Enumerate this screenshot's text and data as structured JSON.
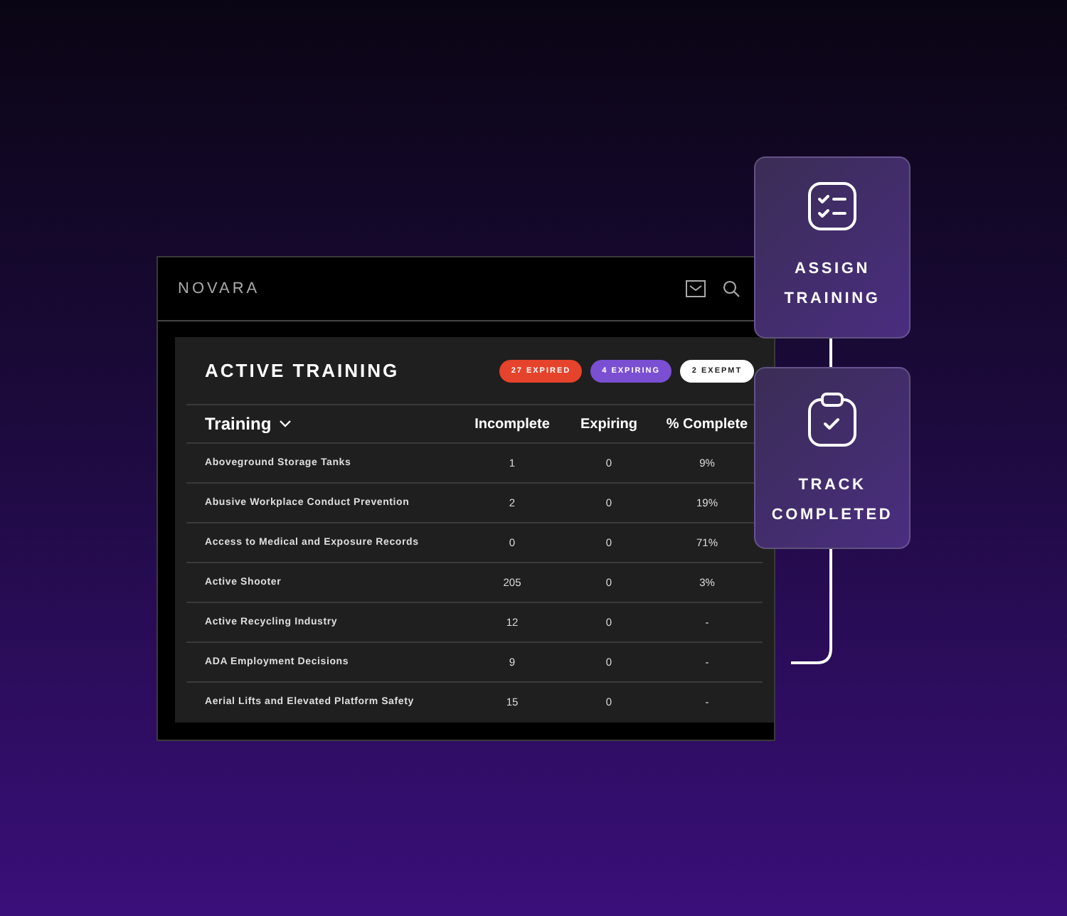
{
  "app": {
    "logo": "NOVARA"
  },
  "panel": {
    "title": "ACTIVE TRAINING",
    "badges": [
      {
        "label": "27 EXPIRED",
        "color": "#e5432b"
      },
      {
        "label": "4 EXPIRING",
        "color": "#7b4fd1"
      },
      {
        "label": "2 EXEPMT",
        "color": "#ffffff"
      }
    ]
  },
  "table": {
    "columns": [
      "Training",
      "Incomplete",
      "Expiring",
      "% Complete"
    ],
    "rows": [
      [
        "Aboveground Storage Tanks",
        "1",
        "0",
        "9%"
      ],
      [
        "Abusive Workplace Conduct Prevention",
        "2",
        "0",
        "19%"
      ],
      [
        "Access to Medical and Exposure Records",
        "0",
        "0",
        "71%"
      ],
      [
        "Active Shooter",
        "205",
        "0",
        "3%"
      ],
      [
        "Active Recycling Industry",
        "12",
        "0",
        "-"
      ],
      [
        "ADA Employment Decisions",
        "9",
        "0",
        "-"
      ],
      [
        "Aerial Lifts and Elevated Platform Safety",
        "15",
        "0",
        "-"
      ]
    ]
  },
  "cards": [
    {
      "kind": "checklist",
      "lines": [
        "ASSIGN",
        "TRAINING"
      ]
    },
    {
      "kind": "clipboard",
      "lines": [
        "TRACK",
        "COMPLETED"
      ]
    }
  ]
}
